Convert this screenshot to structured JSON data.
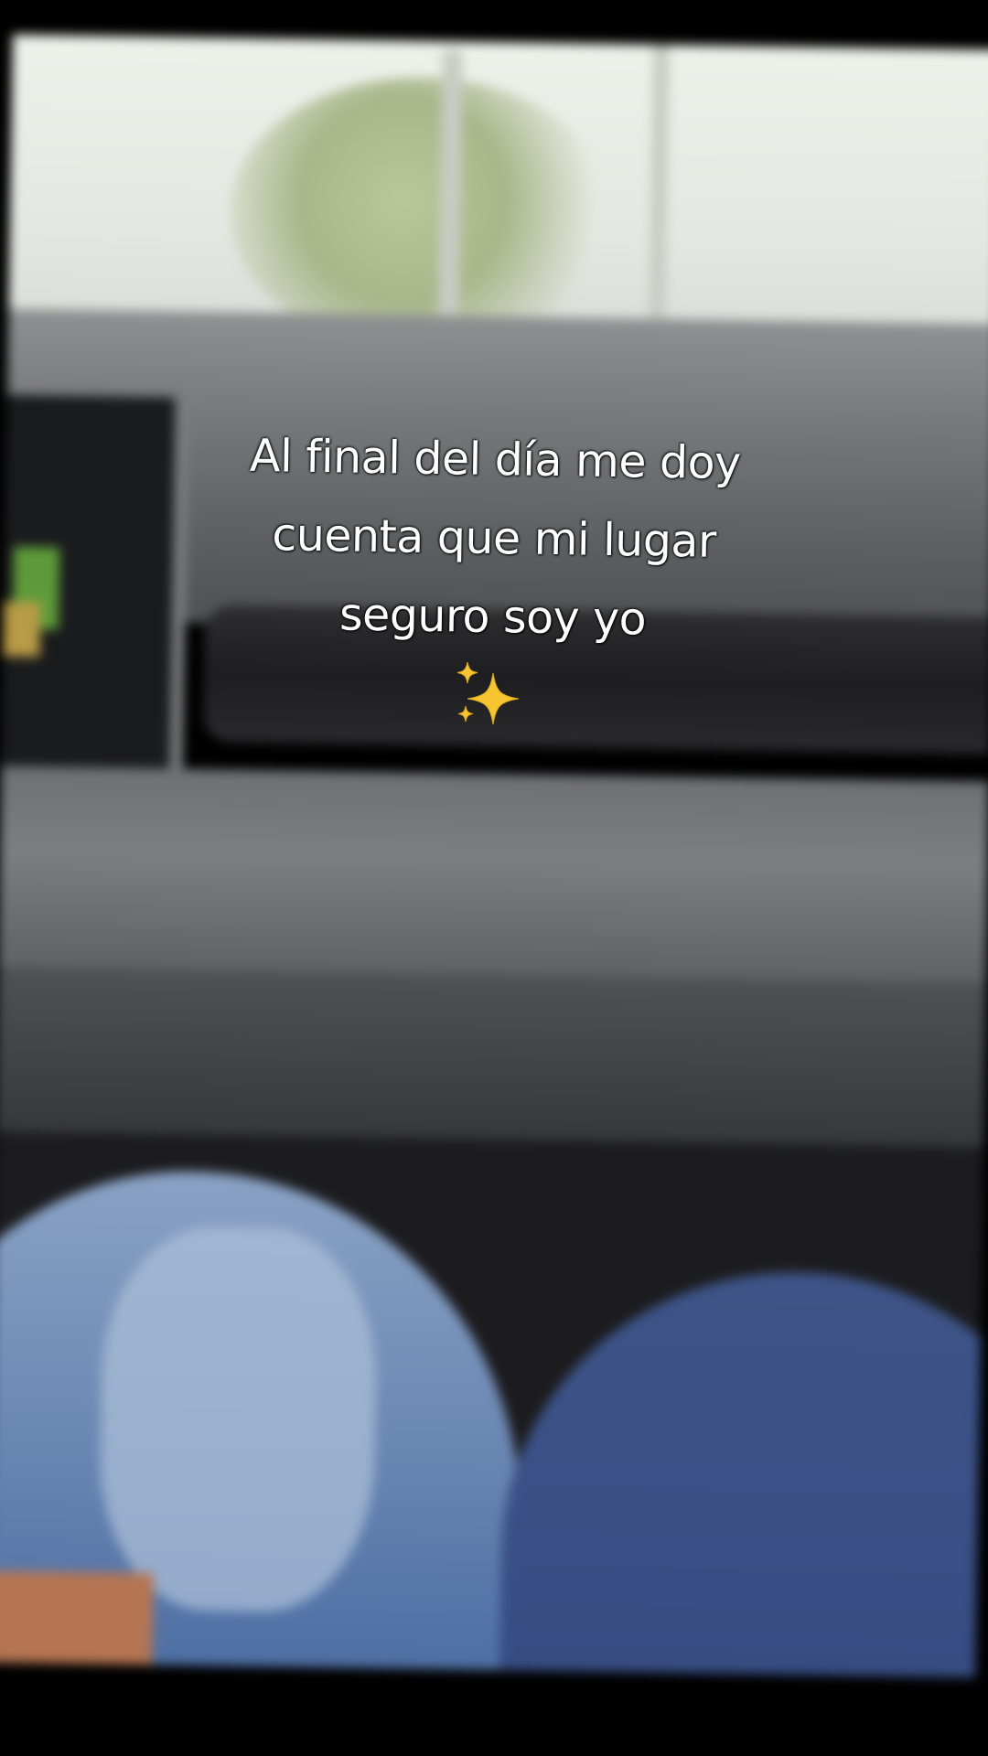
{
  "caption": {
    "lines": [
      "Al final del día me doy",
      "cuenta que mi lugar",
      "seguro soy yo"
    ]
  },
  "sparkle_icon": "sparkles-icon",
  "colors": {
    "caption_text": "#ffffff",
    "sparkle": "#f7c531",
    "jeans": "#5272a6",
    "letterbox": "#000000"
  }
}
